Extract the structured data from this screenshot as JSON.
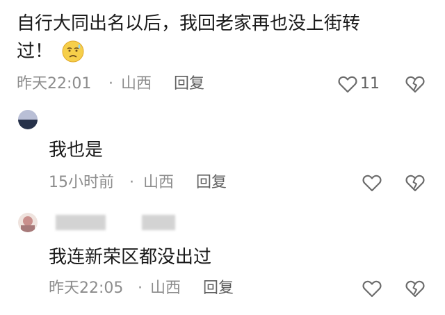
{
  "comments": [
    {
      "text_line1": "自行大同出名以后，我回老家再也没上街转",
      "text_line2": "过！",
      "emoji": "😩",
      "time": "昨天22:01",
      "separator": "·",
      "location": "山西",
      "reply_label": "回复",
      "like_count": "11"
    },
    {
      "text": "我也是",
      "time": "15小时前",
      "separator": "·",
      "location": "山西",
      "reply_label": "回复"
    },
    {
      "text": "我连新荣区都没出过",
      "time": "昨天22:05",
      "separator": "·",
      "location": "山西",
      "reply_label": "回复"
    }
  ],
  "icons": {
    "like": "heart-outline-icon",
    "dislike": "broken-heart-icon"
  },
  "colors": {
    "text": "#1a1a1a",
    "meta": "#8c8c8c",
    "icon": "#6b6b6b",
    "emoji_face": "#f6cf4a"
  }
}
